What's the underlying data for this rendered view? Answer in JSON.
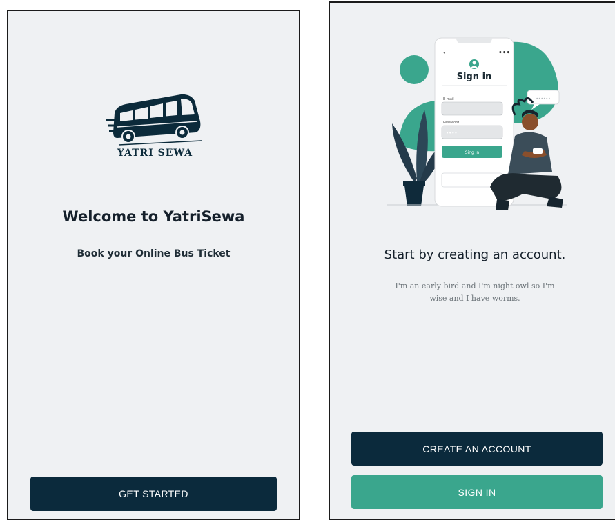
{
  "left_screen": {
    "logo_text": "YATRI SEWA",
    "title": "Welcome to YatriSewa",
    "subtitle": "Book your Online Bus Ticket",
    "button_label": "GET STARTED"
  },
  "right_screen": {
    "illustration": {
      "heading": "Sign in",
      "email_label": "E-mail",
      "password_label": "Password",
      "password_dots": "••••",
      "bubble_dots": "••••••",
      "button_label": "Sing in"
    },
    "title": "Start by creating an account.",
    "description": "I'm an early bird and I'm night owl so I'm wise and I have worms.",
    "create_button_label": "CREATE AN ACCOUNT",
    "signin_button_label": "SIGN IN"
  },
  "colors": {
    "background": "#eff1f3",
    "dark_button": "#0b2a3c",
    "teal_button": "#3aa68d"
  }
}
